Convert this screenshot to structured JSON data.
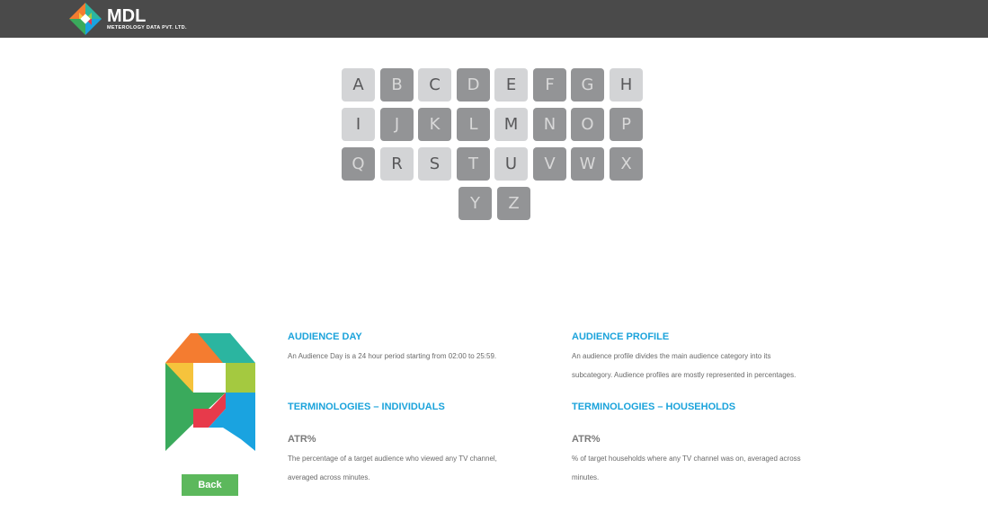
{
  "header": {
    "brand": "MDL",
    "brand_sub": "METEROLOGY DATA PVT. LTD."
  },
  "keyboard": {
    "rows": [
      [
        {
          "letter": "A",
          "shade": "light"
        },
        {
          "letter": "B",
          "shade": "dark"
        },
        {
          "letter": "C",
          "shade": "light"
        },
        {
          "letter": "D",
          "shade": "dark"
        },
        {
          "letter": "E",
          "shade": "light"
        },
        {
          "letter": "F",
          "shade": "dark"
        },
        {
          "letter": "G",
          "shade": "dark"
        },
        {
          "letter": "H",
          "shade": "light"
        }
      ],
      [
        {
          "letter": "I",
          "shade": "light"
        },
        {
          "letter": "J",
          "shade": "dark"
        },
        {
          "letter": "K",
          "shade": "dark"
        },
        {
          "letter": "L",
          "shade": "dark"
        },
        {
          "letter": "M",
          "shade": "light"
        },
        {
          "letter": "N",
          "shade": "dark"
        },
        {
          "letter": "O",
          "shade": "dark"
        },
        {
          "letter": "P",
          "shade": "dark"
        }
      ],
      [
        {
          "letter": "Q",
          "shade": "dark"
        },
        {
          "letter": "R",
          "shade": "light"
        },
        {
          "letter": "S",
          "shade": "light"
        },
        {
          "letter": "T",
          "shade": "dark"
        },
        {
          "letter": "U",
          "shade": "light"
        },
        {
          "letter": "V",
          "shade": "dark"
        },
        {
          "letter": "W",
          "shade": "dark"
        },
        {
          "letter": "X",
          "shade": "dark"
        }
      ],
      [
        {
          "letter": "Y",
          "shade": "dark"
        },
        {
          "letter": "Z",
          "shade": "dark"
        }
      ]
    ]
  },
  "selected_letter": "A",
  "back_label": "Back",
  "terms": {
    "audience_day": {
      "heading": "AUDIENCE DAY",
      "body": "An Audience Day is a 24 hour period starting from 02:00 to 25:59."
    },
    "audience_profile": {
      "heading": "AUDIENCE PROFILE",
      "body_line1": "An audience profile divides the main audience category into its",
      "body_line2": "subcategory. Audience profiles are mostly represented in percentages."
    },
    "individuals": {
      "heading": "TERMINOLOGIES – INDIVIDUALS",
      "sub": "ATR%",
      "body_line1": "The percentage of a target audience who viewed any TV channel,",
      "body_line2": "averaged across minutes."
    },
    "households": {
      "heading": "TERMINOLOGIES – HOUSEHOLDS",
      "sub": "ATR%",
      "body_line1": "% of target households where any TV channel was on, averaged across",
      "body_line2": "minutes."
    }
  },
  "colors": {
    "header_bg": "#4a4a4a",
    "accent_blue": "#1ba3db",
    "back_green": "#5cb85c",
    "key_light": "#d3d4d6",
    "key_dark": "#939496"
  }
}
